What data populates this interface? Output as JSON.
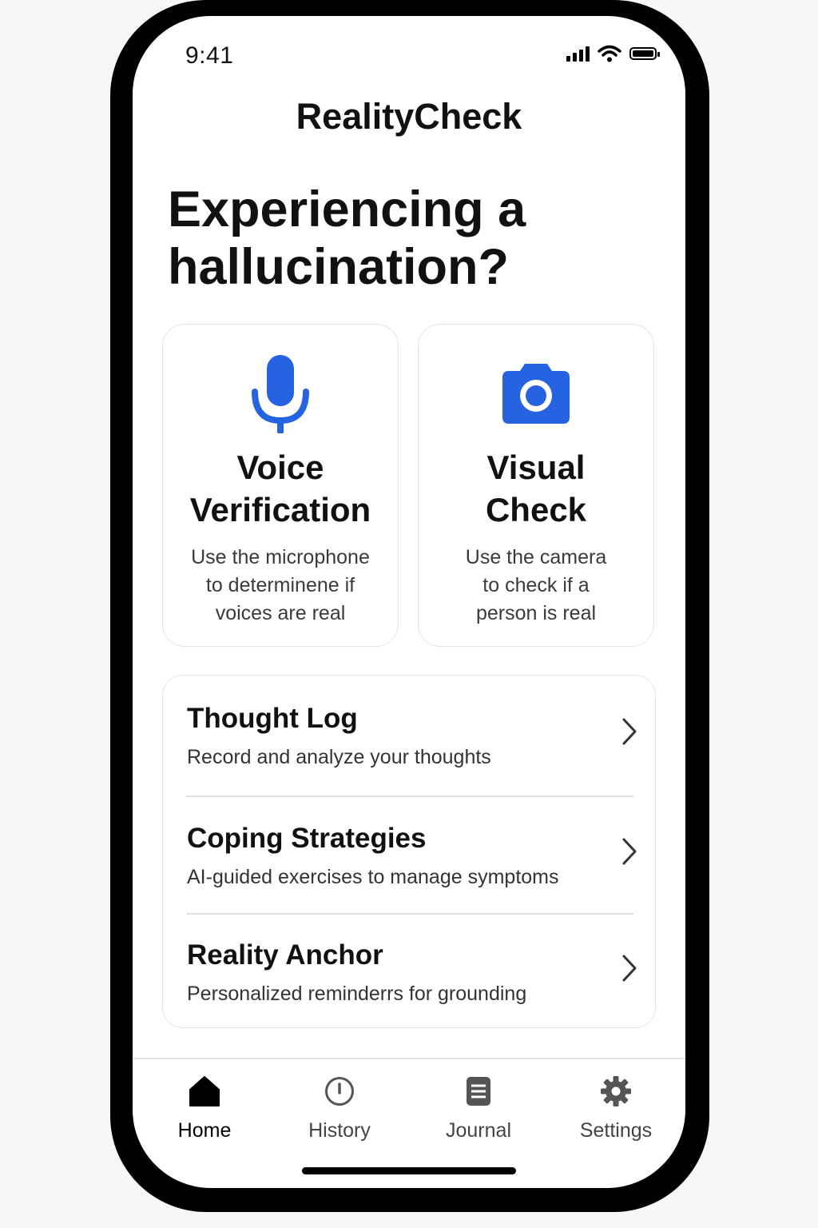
{
  "status_bar": {
    "time": "9:41"
  },
  "app": {
    "title": "RealityCheck"
  },
  "headline": "Experiencing a hallucination?",
  "actions": [
    {
      "title_line1": "Voice",
      "title_line2": "Verification",
      "desc_line1": "Use the microphone",
      "desc_line2": "to determinene if",
      "desc_line3": "voices are real",
      "icon": "microphone-icon"
    },
    {
      "title_line1": "Visual",
      "title_line2": "Check",
      "desc_line1": "Use the camera",
      "desc_line2": "to check if a",
      "desc_line3": "person is real",
      "icon": "camera-icon"
    }
  ],
  "menu": [
    {
      "title": "Thought Log",
      "subtitle": "Record and analyze your  thoughts"
    },
    {
      "title": "Coping Strategies",
      "subtitle": "AI-guided exercises to manage symptoms"
    },
    {
      "title": "Reality Anchor",
      "subtitle": "Personalized reminderrs for grounding"
    }
  ],
  "tabs": [
    {
      "label": "Home",
      "icon": "home-icon",
      "active": true
    },
    {
      "label": "History",
      "icon": "clock-icon",
      "active": false
    },
    {
      "label": "Journal",
      "icon": "journal-icon",
      "active": false
    },
    {
      "label": "Settings",
      "icon": "gear-icon",
      "active": false
    }
  ],
  "colors": {
    "accent": "#2563e0",
    "text": "#111111",
    "border": "#e4e4e4"
  }
}
